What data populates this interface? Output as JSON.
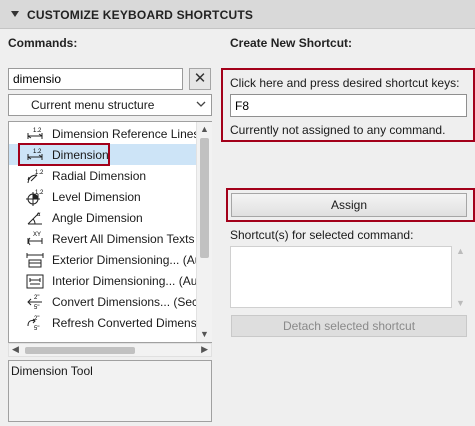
{
  "header": {
    "title": "CUSTOMIZE KEYBOARD SHORTCUTS"
  },
  "left": {
    "commands_label": "Commands:",
    "search_value": "dimensio",
    "clear_glyph": "✕",
    "menu_select": "Current menu structure",
    "items": [
      {
        "label": "Dimension Reference Lines",
        "icon": "dimension-reference-lines-icon"
      },
      {
        "label": "Dimension",
        "icon": "dimension-icon",
        "selected": true
      },
      {
        "label": "Radial Dimension",
        "icon": "radial-dimension-icon"
      },
      {
        "label": "Level Dimension",
        "icon": "level-dimension-icon"
      },
      {
        "label": "Angle Dimension",
        "icon": "angle-dimension-icon"
      },
      {
        "label": "Revert All Dimension Texts to",
        "icon": "revert-dimension-texts-icon"
      },
      {
        "label": "Exterior Dimensioning... (Aut",
        "icon": "exterior-dimensioning-icon"
      },
      {
        "label": "Interior Dimensioning... (Aut",
        "icon": "interior-dimensioning-icon"
      },
      {
        "label": "Convert Dimensions... (Secor",
        "icon": "convert-dimensions-icon"
      },
      {
        "label": "Refresh Converted Dimensic",
        "icon": "refresh-converted-dimensions-icon"
      }
    ],
    "description": "Dimension Tool"
  },
  "right": {
    "create_label": "Create New Shortcut:",
    "press_prompt": "Click here and press desired shortcut keys:",
    "shortcut_value": "F8",
    "assignment_status": "Currently not assigned to any command.",
    "assign_button": "Assign",
    "shortcuts_label": "Shortcut(s) for selected command:",
    "detach_button": "Detach selected shortcut"
  },
  "colors": {
    "highlight": "#a3001a",
    "selection": "#cde4f7"
  }
}
